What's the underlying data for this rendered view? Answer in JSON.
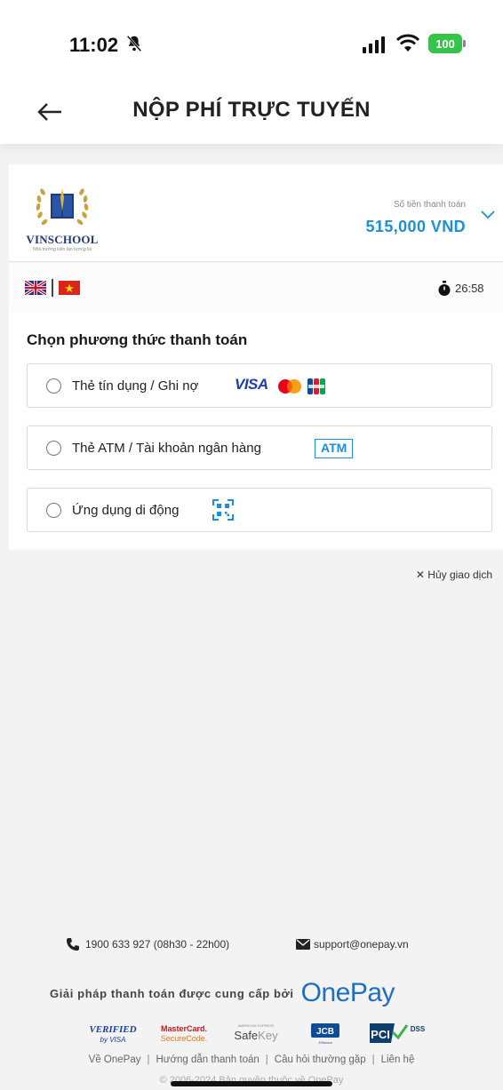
{
  "status_bar": {
    "time": "11:02",
    "battery": "100"
  },
  "header": {
    "title": "NỘP PHÍ TRỰC TUYẾN"
  },
  "merchant": {
    "logo_name": "VINSCHOOL",
    "logo_tagline": "Nhà trường kiến tạo tương lai",
    "amount_label": "Số tiền thanh toán",
    "amount_value": "515,000 VND"
  },
  "session": {
    "timer": "26:58"
  },
  "methods": {
    "title": "Chọn phương thức thanh toán",
    "items": [
      {
        "label": "Thẻ tín dụng / Ghi nợ",
        "brand": "VISA"
      },
      {
        "label": "Thẻ ATM / Tài khoản ngân hàng",
        "badge": "ATM"
      },
      {
        "label": "Ứng dụng di động"
      }
    ]
  },
  "cancel": {
    "label": "✕ Hủy giao dịch"
  },
  "footer": {
    "phone": "1900 633 927 (08h30 - 22h00)",
    "email": "support@onepay.vn",
    "provider_text": "Giải pháp thanh toán được cung cấp bởi",
    "provider_brand": "OnePay",
    "badges": [
      "Verified by VISA",
      "MasterCard SecureCode",
      "SafeKey",
      "JCB",
      "PCI DSS"
    ],
    "links": [
      "Về OnePay",
      "Hướng dẫn thanh toán",
      "Câu hỏi thường gặp",
      "Liên hệ"
    ],
    "copyright": "© 2006-2024 Bản quyền thuộc về OnePay"
  },
  "colors": {
    "accent": "#1c8fd6",
    "brand": "#1c6fc4",
    "battery": "#36c34a"
  }
}
